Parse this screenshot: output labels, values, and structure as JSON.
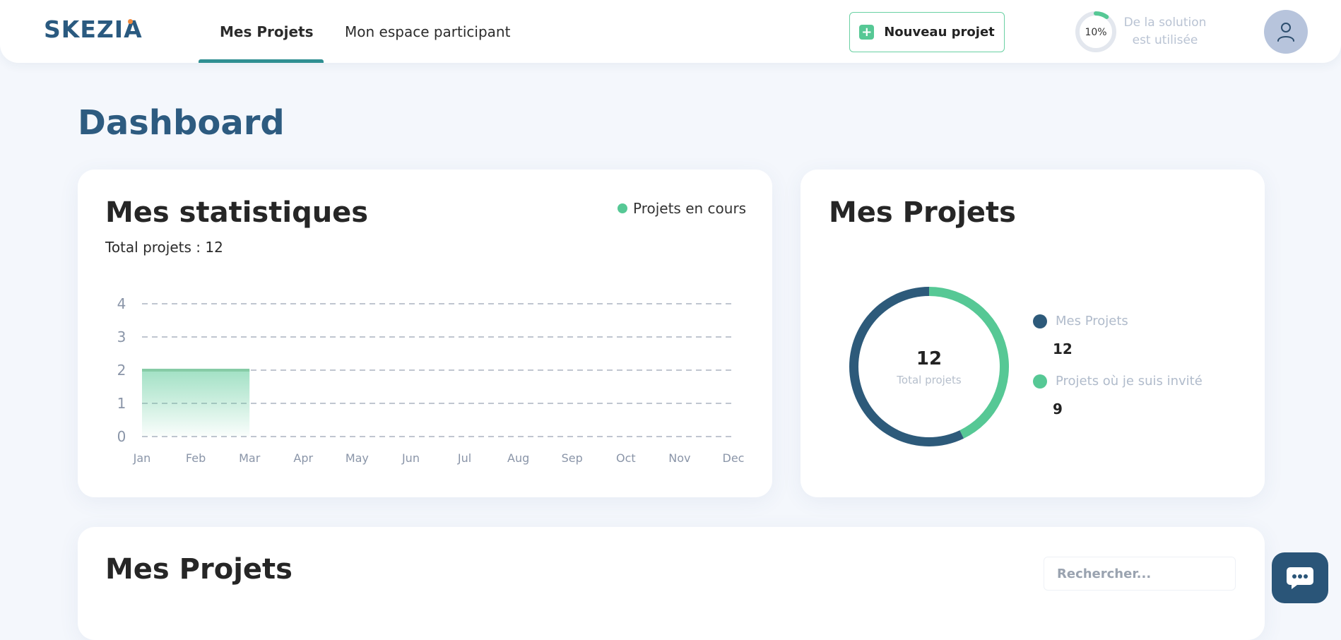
{
  "header": {
    "logo": "SKEZIA",
    "tabs": [
      {
        "label": "Mes Projets",
        "active": true
      },
      {
        "label": "Mon espace participant",
        "active": false
      }
    ],
    "new_project_label": "Nouveau projet",
    "usage": {
      "percent_label": "10%",
      "percent": 10,
      "text_line1": "De la solution",
      "text_line2": "est utilisée"
    }
  },
  "page": {
    "title": "Dashboard"
  },
  "stats_card": {
    "title": "Mes statistiques",
    "legend_label": "Projets en cours",
    "total_label": "Total projets : 12"
  },
  "projects_card": {
    "title": "Mes Projets",
    "center_value": "12",
    "center_label": "Total projets",
    "legend": [
      {
        "label": "Mes Projets",
        "value": "12",
        "color": "#2d5a7a"
      },
      {
        "label": "Projets où je suis invité",
        "value": "9",
        "color": "#56c895"
      }
    ]
  },
  "list_card": {
    "title": "Mes Projets",
    "search_placeholder": "Rechercher..."
  },
  "colors": {
    "primary": "#2d5b80",
    "accent": "#56c895",
    "teal": "#2f8f92"
  },
  "chart_data": [
    {
      "type": "area",
      "categories": [
        "Jan",
        "Feb",
        "Mar",
        "Apr",
        "May",
        "Jun",
        "Jul",
        "Aug",
        "Sep",
        "Oct",
        "Nov",
        "Dec"
      ],
      "series": [
        {
          "name": "Projets en cours",
          "values": [
            2,
            2,
            2,
            null,
            null,
            null,
            null,
            null,
            null,
            null,
            null,
            null
          ]
        }
      ],
      "yticks": [
        0,
        1,
        2,
        3,
        4
      ],
      "ylim": [
        0,
        4
      ],
      "grid": true,
      "legend": "top-right"
    },
    {
      "type": "pie",
      "donut": true,
      "labels": [
        "Mes Projets",
        "Projets où je suis invité"
      ],
      "values": [
        12,
        9
      ],
      "legend": "right"
    }
  ]
}
